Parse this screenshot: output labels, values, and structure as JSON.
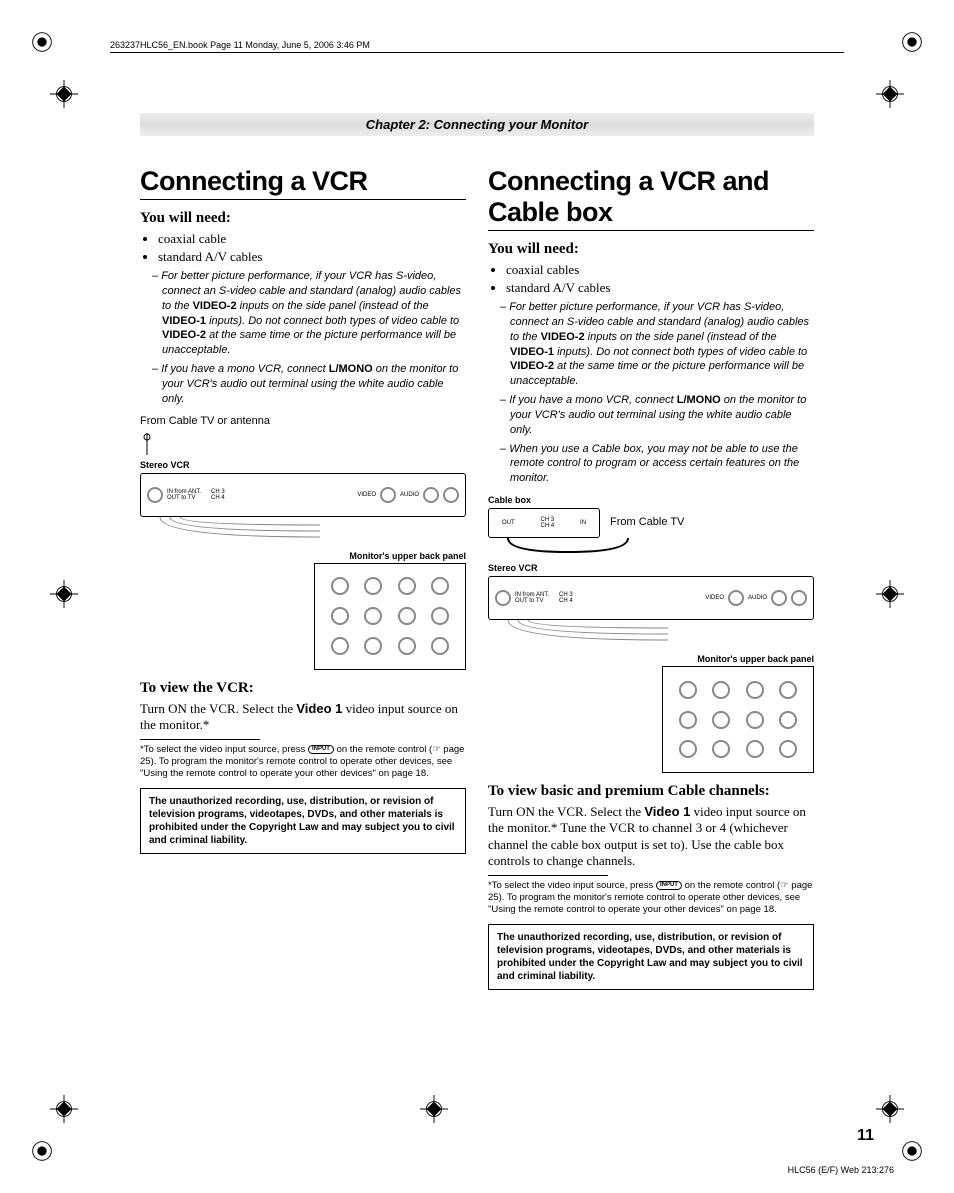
{
  "header_line": "263237HLC56_EN.book  Page 11  Monday, June 5, 2006  3:46 PM",
  "chapter_bar": "Chapter 2: Connecting your Monitor",
  "left": {
    "title": "Connecting a VCR",
    "need_heading": "You will need:",
    "need_items": [
      "coaxial cable",
      "standard A/V cables"
    ],
    "note1_pre": "For better picture performance, if your VCR has S-video, connect an S-video cable and standard (analog) audio cables to the ",
    "note1_b1": "VIDEO-2",
    "note1_mid": " inputs on the side panel (instead of the ",
    "note1_b2": "VIDEO-1",
    "note1_mid2": " inputs). Do not connect both types of video cable to ",
    "note1_b3": "VIDEO-2",
    "note1_post": " at the same time or the picture performance will be unacceptable.",
    "note2_pre": "If you have a mono VCR, connect ",
    "note2_b1": "L/MONO",
    "note2_post": " on the monitor to your VCR's audio out terminal using the white audio cable only.",
    "diagram_from": "From Cable TV or antenna",
    "diag_vcr_label": "Stereo VCR",
    "diag_panel_label": "Monitor's upper back panel",
    "diag_video": "VIDEO",
    "diag_audio": "AUDIO",
    "diag_in_ant": "IN from ANT.",
    "diag_out_tv": "OUT to TV",
    "diag_ch3": "CH 3",
    "diag_ch4": "CH 4",
    "view_heading": "To view the VCR:",
    "view_text_pre": "Turn ON the VCR. Select the ",
    "view_text_b": "Video 1",
    "view_text_post": " video input source on the monitor.*",
    "footnote_pre": "*To select the video input source, press ",
    "footnote_btn": "INPUT",
    "footnote_post": " on the remote control (☞ page 25). To program the monitor's remote control to operate other devices, see \"Using the remote control to operate your other devices\" on page 18.",
    "warning": "The unauthorized recording, use, distribution, or revision of television programs, videotapes, DVDs, and other materials is prohibited under the Copyright Law and may subject you to civil and criminal liability."
  },
  "right": {
    "title": "Connecting a VCR and Cable box",
    "need_heading": "You will need:",
    "need_items": [
      "coaxial cables",
      "standard A/V cables"
    ],
    "note1_pre": "For better picture performance, if your VCR has S-video, connect an S-video cable and standard (analog) audio cables to the ",
    "note1_b1": "VIDEO-2",
    "note1_mid": " inputs on the side panel (instead of the ",
    "note1_b2": "VIDEO-1",
    "note1_mid2": " inputs). Do not connect both types of video cable to ",
    "note1_b3": "VIDEO-2",
    "note1_post": " at the same time or the picture performance will be unacceptable.",
    "note2_pre": "If you have a mono VCR, connect ",
    "note2_b1": "L/MONO",
    "note2_post": " on the monitor to your VCR's audio out terminal using the white audio cable only.",
    "note3": "When you use a Cable box, you may not be able to use the remote control to program or access certain features on the monitor.",
    "diag_cablebox": "Cable box",
    "diag_from_cable": "From Cable TV",
    "diag_out": "OUT",
    "diag_in": "IN",
    "diag_ch3": "CH 3",
    "diag_ch4": "CH 4",
    "diag_vcr_label": "Stereo VCR",
    "diag_panel_label": "Monitor's upper back panel",
    "diag_video": "VIDEO",
    "diag_audio": "AUDIO",
    "diag_in_ant": "IN from ANT.",
    "diag_out_tv": "OUT to TV",
    "view_heading": "To view basic and premium Cable channels:",
    "view_text_pre": "Turn ON the VCR. Select the ",
    "view_text_b": "Video 1",
    "view_text_post": " video input source on the monitor.* Tune the VCR to channel 3 or 4 (whichever channel the cable box output is set to). Use the cable box controls to change channels.",
    "footnote_pre": "*To select the video input source, press ",
    "footnote_btn": "INPUT",
    "footnote_post": " on the remote control (☞ page 25). To program the monitor's remote control to operate other devices, see \"Using the remote control to operate your other devices\" on page 18.",
    "warning": "The unauthorized recording, use, distribution, or revision of television programs, videotapes, DVDs, and other materials is prohibited under the Copyright Law and may subject you to civil and criminal liability."
  },
  "page_number": "11",
  "doc_code": "HLC56 (E/F) Web 213:276"
}
